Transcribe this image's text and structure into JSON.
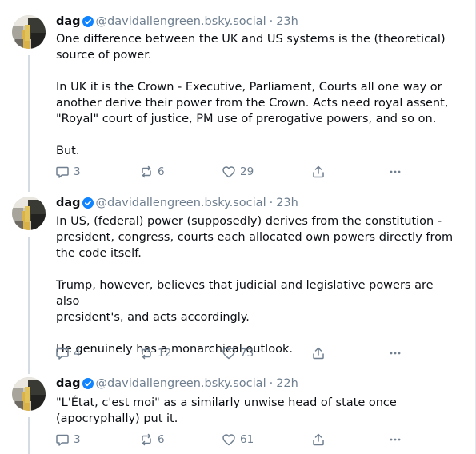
{
  "author": {
    "display_name": "dag",
    "handle": "@davidallengreen.bsky.social",
    "verified": true,
    "avatar_icon": "profile-photo"
  },
  "colors": {
    "text": "#0b0f14",
    "muted": "#6f7f8f",
    "verified": "#1083fe",
    "thread_line": "#d4dbe2"
  },
  "posts": [
    {
      "time": "23h",
      "paragraphs": [
        [
          "One difference between the UK and US systems is the (theoretical)",
          "source of power."
        ],
        [
          "In UK it is the Crown - Executive, Parliament, Courts all one way or",
          "another derive their power from the Crown.  Acts need royal assent,",
          "\"Royal\" court of justice, PM use of prerogative powers, and so on."
        ],
        [
          "But."
        ]
      ],
      "replies": "3",
      "reposts": "6",
      "likes": "29"
    },
    {
      "time": "23h",
      "paragraphs": [
        [
          "In US, (federal) power (supposedly) derives from the constitution -",
          "president, congress, courts each allocated own powers directly from",
          "the code itself."
        ],
        [
          "Trump, however, believes that judicial and legislative powers are also",
          "president's, and acts accordingly."
        ],
        [
          "He genuinely has a monarchical outlook."
        ]
      ],
      "replies": "4",
      "reposts": "12",
      "likes": "73"
    },
    {
      "time": "22h",
      "paragraphs": [
        [
          "\"L'État, c'est moi\" as a similarly unwise head of state once",
          "(apocryphally) put it."
        ]
      ],
      "replies": "3",
      "reposts": "6",
      "likes": "61"
    }
  ],
  "icons": {
    "reply": "reply-icon",
    "repost": "repost-icon",
    "like": "heart-icon",
    "share": "share-icon",
    "more": "more-icon"
  }
}
